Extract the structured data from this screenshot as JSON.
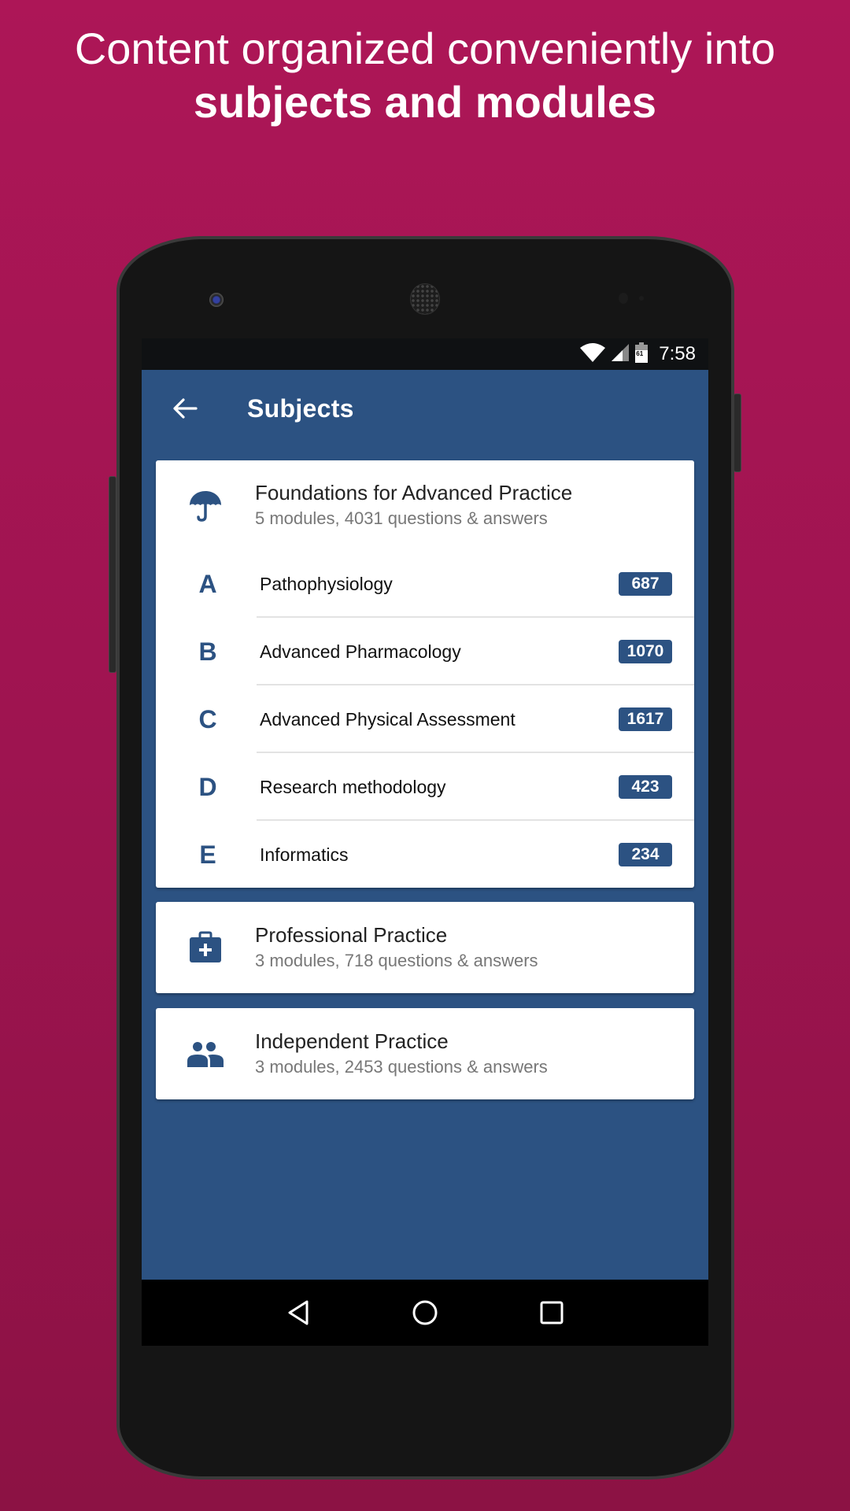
{
  "headline": {
    "line1": "Content organized conveniently into",
    "line2": "subjects and modules"
  },
  "status_bar": {
    "time": "7:58",
    "battery_level": "61",
    "icons": [
      "wifi-icon",
      "signal-icon",
      "battery-icon"
    ]
  },
  "app_bar": {
    "title": "Subjects",
    "back_icon": "arrow-left-icon"
  },
  "subjects": [
    {
      "title": "Foundations for Advanced Practice",
      "subtitle": "5 modules, 4031 questions & answers",
      "icon": "umbrella-icon",
      "expanded": true,
      "modules": [
        {
          "letter": "A",
          "name": "Pathophysiology",
          "count": "687"
        },
        {
          "letter": "B",
          "name": "Advanced Pharmacology",
          "count": "1070"
        },
        {
          "letter": "C",
          "name": "Advanced Physical Assessment",
          "count": "1617"
        },
        {
          "letter": "D",
          "name": "Research methodology",
          "count": "423"
        },
        {
          "letter": "E",
          "name": "Informatics",
          "count": "234"
        }
      ]
    },
    {
      "title": "Professional Practice",
      "subtitle": "3 modules, 718 questions & answers",
      "icon": "medical-bag-icon",
      "expanded": false
    },
    {
      "title": "Independent Practice",
      "subtitle": "3 modules, 2453 questions & answers",
      "icon": "people-icon",
      "expanded": false
    }
  ],
  "nav_bar": {
    "buttons": [
      "back",
      "home",
      "recents"
    ]
  },
  "colors": {
    "background": "#ad1657",
    "primary": "#2c5282",
    "status_bar": "#0f1113",
    "card": "#ffffff"
  }
}
